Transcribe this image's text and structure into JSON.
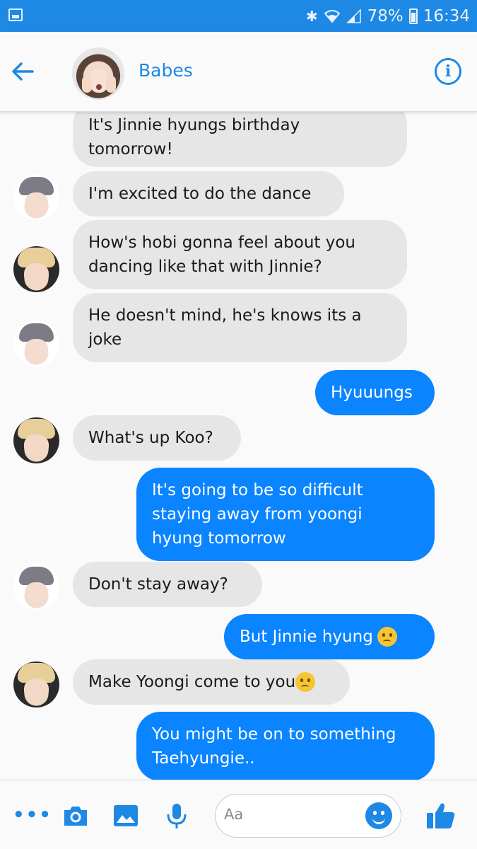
{
  "status_bar": {
    "battery": "78%",
    "time": "16:34"
  },
  "header": {
    "contact_name": "Babes",
    "info_glyph": "i",
    "back_icon": "arrow-left-icon"
  },
  "messages": [
    {
      "from": "received",
      "text": "It's Jinnie hyungs birthday\ntomorrow!",
      "avatar": null
    },
    {
      "from": "received",
      "text": "I'm excited to do the dance",
      "avatar": "jimin"
    },
    {
      "from": "received",
      "text": "How's hobi gonna feel about you\ndancing like that with Jinnie?",
      "avatar": "tae"
    },
    {
      "from": "received",
      "text": "He doesn't mind, he's knows its a\njoke",
      "avatar": "jimin"
    },
    {
      "from": "sent",
      "text": "Hyuuungs"
    },
    {
      "from": "received",
      "text": "What's up Koo?",
      "avatar": "tae"
    },
    {
      "from": "sent",
      "text": "It's going to be so difficult\nstaying away from yoongi\nhyung tomorrow"
    },
    {
      "from": "received",
      "text": "Don't stay away?",
      "avatar": "jimin"
    },
    {
      "from": "sent",
      "text": "But Jinnie hyung",
      "emoji": "worried-face-icon"
    },
    {
      "from": "received",
      "text": "Make Yoongi come to you",
      "avatar": "tae",
      "emoji": "smirk-face-icon"
    },
    {
      "from": "sent",
      "text": "You might be on to something\nTaehyungie.."
    }
  ],
  "composer": {
    "placeholder": "Aa"
  },
  "toolbar_icons": [
    "more-icon",
    "camera-icon",
    "gallery-icon",
    "microphone-icon",
    "emoji-icon",
    "thumbs-up-icon"
  ],
  "colors": {
    "status_bar": "#1e88e5",
    "accent": "#1e88e5",
    "sent_bubble": "#0a84ff",
    "received_bubble": "#e6e6e6"
  }
}
